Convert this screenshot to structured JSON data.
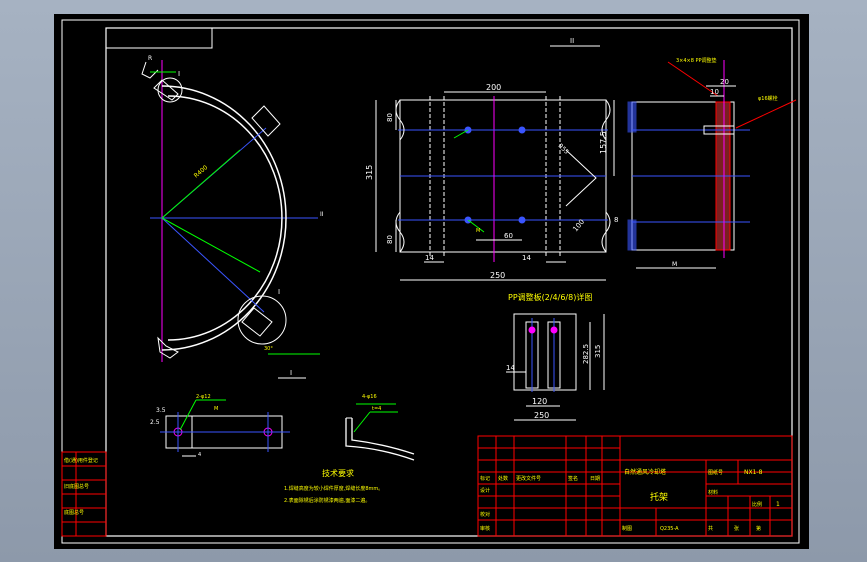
{
  "colors": {
    "background": "#a6b2c2",
    "sheet": "#000000",
    "line": "#ffffff",
    "center_line": "#ff00ff",
    "axis_line": "#3a55ff",
    "dimension": "#00ff00",
    "table": "#ff0000",
    "text": "#ffff00"
  },
  "views": {
    "section_top_label": "II",
    "section_left_label": "I",
    "detail_mark_top": "I",
    "detail_mark_bottom": "I",
    "axis_mark": "II",
    "radius_text": "R400",
    "bottom_note": "30°",
    "top_arrow": "R"
  },
  "dims_main": {
    "d200": "200",
    "d80_top": "80",
    "d315": "315",
    "d80_bot": "80",
    "d157_5": "157.5",
    "d14_left": "14",
    "d60": "60",
    "d14_right": "14",
    "d250": "250",
    "d_diag1": "R55",
    "d_diag2": "100",
    "hole_small": "M"
  },
  "side_view": {
    "note": "3×4×8 PP调整垫",
    "d20": "20",
    "d10": "10",
    "label_right": "φ16螺栓",
    "d8": "8",
    "base_label": "M"
  },
  "detail_plate": {
    "title": "PP调整板(2/4/6/8)详图",
    "d315": "315",
    "d282_5": "282.5",
    "d14": "14",
    "d120": "120",
    "d250": "250"
  },
  "small_views": {
    "hole_note": "2-φ12",
    "hole_sub": "M",
    "d3_5": "3.5",
    "d2_5": "2.5",
    "d4": "4",
    "bend_note": "4-φ16",
    "bend_sub": "t=4"
  },
  "tech": {
    "title": "技术要求",
    "line1": "1.焊缝高度为较小焊件厚度,焊缝长度8mm。",
    "line2": "2.表面除锈后涂防锈漆两遍,面漆二遍。"
  },
  "title_block": {
    "project": "自然通风冷却塔",
    "drawing_no_label": "图纸号",
    "drawing_no": "NX1-8",
    "part_name": "托架",
    "scale_label": "比例",
    "scale": "1",
    "material_label": "材料",
    "sheet_label": "共",
    "sheet_a": "张",
    "sheet_b": "第",
    "design_label": "设计",
    "check_label": "校对",
    "approve_label": "审核",
    "draw_label": "制图",
    "code_label": "Q235-A",
    "rev_label": "标记",
    "qty_label": "处数",
    "change_label": "更改文件号",
    "sign_label": "签名",
    "date_label": "日期"
  },
  "left_strip": {
    "label1": "借(通)用件登记",
    "label2": "旧底图总号",
    "label3": "底图总号"
  }
}
